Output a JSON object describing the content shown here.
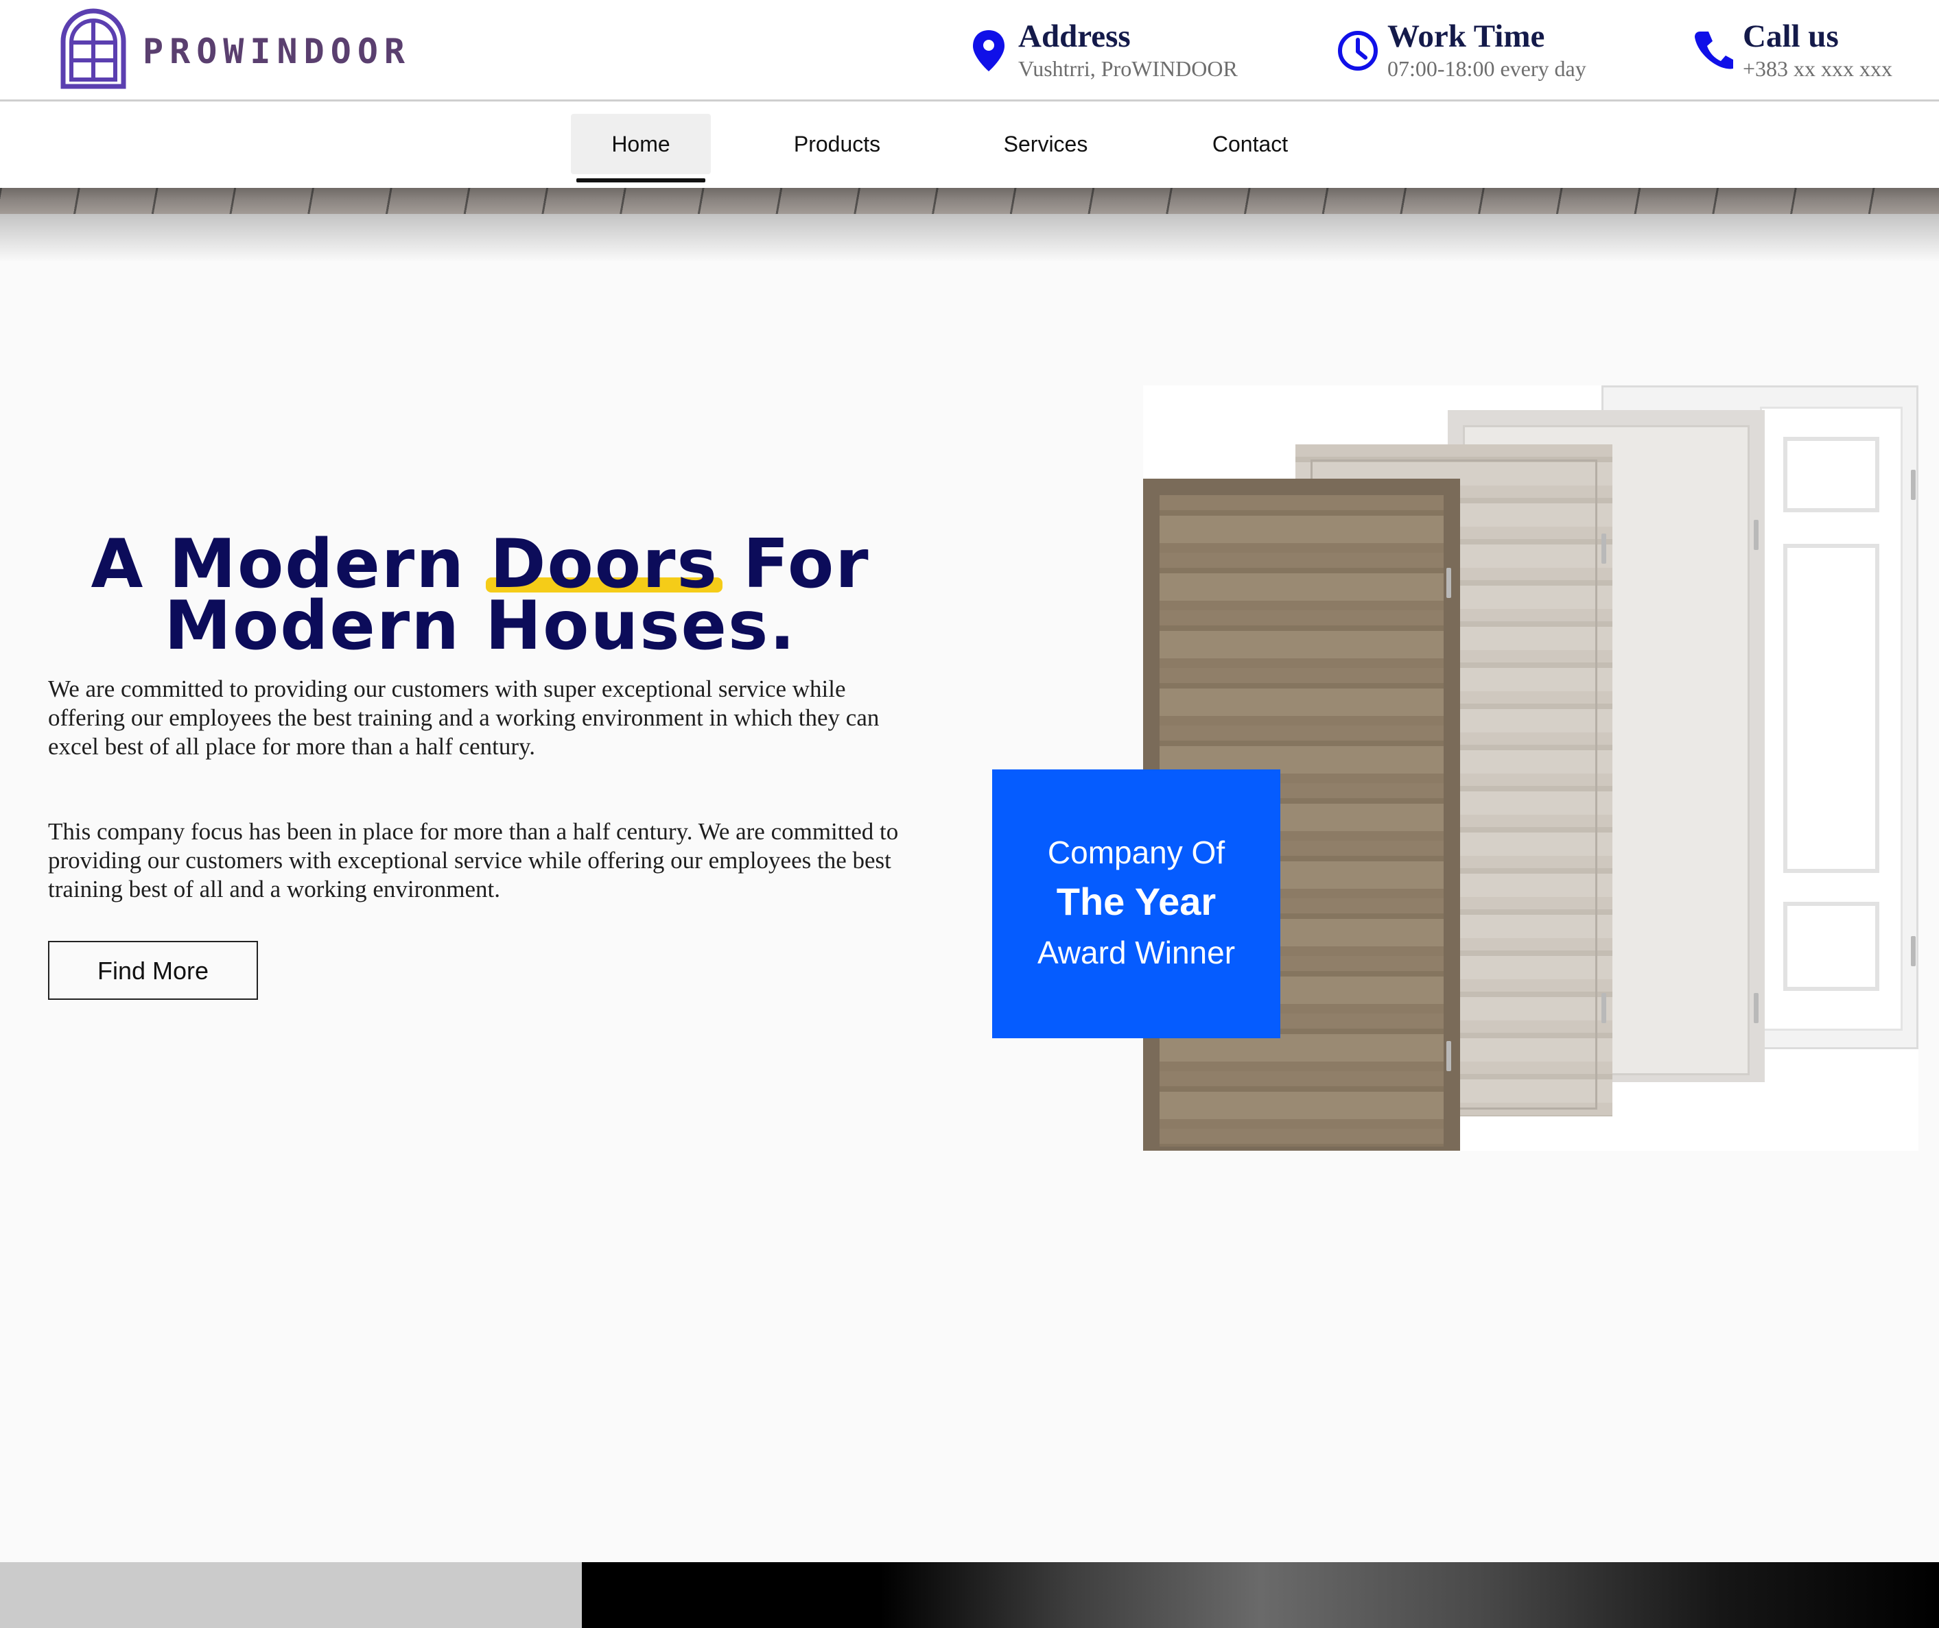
{
  "brand": {
    "name": "PROWINDOOR"
  },
  "header": {
    "address": {
      "title": "Address",
      "value": "Vushtrri, ProWINDOOR",
      "icon": "location-pin-icon"
    },
    "work_time": {
      "title": "Work Time",
      "value": "07:00-18:00 every day",
      "icon": "clock-icon"
    },
    "call": {
      "title": "Call us",
      "value": "+383 xx xxx xxx",
      "icon": "phone-icon"
    }
  },
  "nav": {
    "items": [
      {
        "label": "Home",
        "active": true
      },
      {
        "label": "Products",
        "active": false
      },
      {
        "label": "Services",
        "active": false
      },
      {
        "label": "Contact",
        "active": false
      }
    ]
  },
  "hero": {
    "headline_part1": "A Modern",
    "headline_highlight": "Doors",
    "headline_part2": "For",
    "headline_line2": "Modern Houses.",
    "paragraph1": "We are committed to providing our customers with super exceptional service while offering our employees the best training and a working environment in which they can excel best of all place for more than a half century.",
    "paragraph2": "This company focus has been in place for more than a half century. We are committed to providing our customers with exceptional service while offering our employees the best training best of all and a working environment.",
    "button_label": "Find More"
  },
  "award": {
    "line1": "Company Of",
    "line2": "The Year",
    "line3": "Award Winner"
  },
  "colors": {
    "accent_blue": "#055cff",
    "icon_blue": "#1010e8",
    "headline_navy": "#0c0c5a",
    "highlight_yellow": "#f5cc18",
    "logo_purple": "#5a3f6f"
  }
}
